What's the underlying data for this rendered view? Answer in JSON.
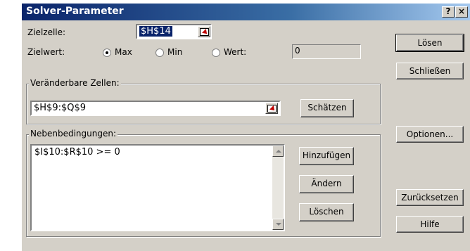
{
  "window": {
    "title": "Solver-Parameter",
    "help_btn": "?",
    "close_btn": "×"
  },
  "target_cell": {
    "label": "Zielzelle:",
    "value": "$H$14"
  },
  "target_value": {
    "label": "Zielwert:",
    "options": [
      {
        "label": "Max",
        "selected": true
      },
      {
        "label": "Min",
        "selected": false
      },
      {
        "label": "Wert:",
        "selected": false
      }
    ],
    "value_field": "0"
  },
  "changing_cells": {
    "title": "Veränderbare Zellen:",
    "value": "$H$9:$Q$9",
    "guess_btn": "Schätzen"
  },
  "constraints": {
    "title": "Nebenbedingungen:",
    "items": [
      "$I$10:$R$10 >= 0"
    ],
    "add_btn": "Hinzufügen",
    "change_btn": "Ändern",
    "delete_btn": "Löschen"
  },
  "right_buttons": {
    "solve": "Lösen",
    "close": "Schließen",
    "options": "Optionen...",
    "reset": "Zurücksetzen",
    "help": "Hilfe"
  }
}
